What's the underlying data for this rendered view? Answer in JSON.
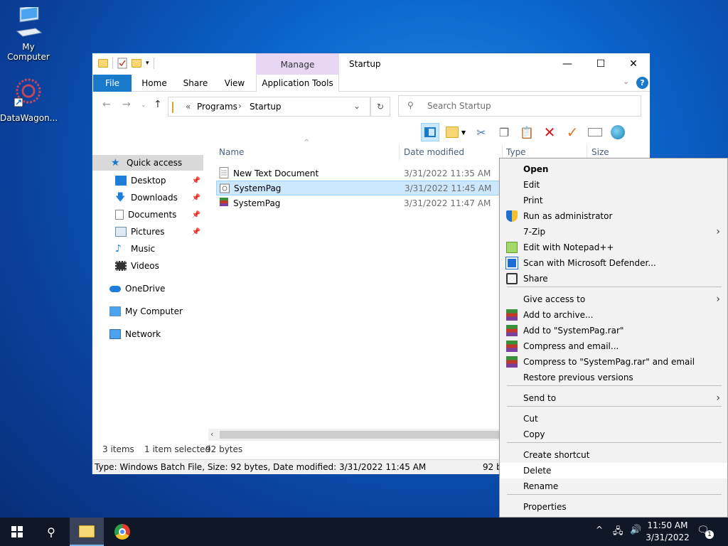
{
  "desktop": {
    "icons": [
      {
        "label": "My Computer",
        "icon": "computer-icon"
      },
      {
        "label": "DataWagon...",
        "icon": "datawagon-shortcut-icon"
      }
    ]
  },
  "window": {
    "title": "Startup",
    "manage_label": "Manage",
    "tabs": [
      "File",
      "Home",
      "Share",
      "View",
      "Application Tools"
    ],
    "controls": {
      "minimize": "—",
      "maximize": "☐",
      "close": "✕"
    },
    "help": "?",
    "address": {
      "crumbs_prefix": "«",
      "crumbs": [
        "Programs",
        "Startup"
      ]
    },
    "search_placeholder": "Search Startup",
    "nav": {
      "quick_access": "Quick access",
      "items": [
        "Desktop",
        "Downloads",
        "Documents",
        "Pictures",
        "Music",
        "Videos"
      ],
      "onedrive": "OneDrive",
      "computer": "My Computer",
      "network": "Network"
    },
    "columns": [
      "Name",
      "Date modified",
      "Type",
      "Size"
    ],
    "files": [
      {
        "name": "New Text Document",
        "date": "3/31/2022 11:35 AM",
        "selected": false
      },
      {
        "name": "SystemPag",
        "date": "3/31/2022 11:45 AM",
        "selected": true
      },
      {
        "name": "SystemPag",
        "date": "3/31/2022 11:47 AM",
        "selected": false
      }
    ],
    "status": {
      "items": "3 items",
      "selected": "1 item selected",
      "size": "92 bytes"
    },
    "info": "Type: Windows Batch File, Size: 92 bytes, Date modified: 3/31/2022 11:45 AM",
    "info_right": "92 b"
  },
  "context_menu": {
    "items": [
      {
        "label": "Open",
        "bold": true
      },
      {
        "label": "Edit"
      },
      {
        "label": "Print"
      },
      {
        "label": "Run as administrator",
        "icon": "uac-shield-icon"
      },
      {
        "label": "7-Zip",
        "submenu": true
      },
      {
        "label": "Edit with Notepad++",
        "icon": "notepadpp-icon"
      },
      {
        "label": "Scan with Microsoft Defender...",
        "icon": "defender-icon"
      },
      {
        "label": "Share",
        "icon": "share-icon"
      },
      {
        "label": "Give access to",
        "submenu": true
      },
      {
        "label": "Add to archive...",
        "icon": "winrar-icon"
      },
      {
        "label": "Add to \"SystemPag.rar\"",
        "icon": "winrar-icon"
      },
      {
        "label": "Compress and email...",
        "icon": "winrar-icon"
      },
      {
        "label": "Compress to \"SystemPag.rar\" and email",
        "icon": "winrar-icon"
      },
      {
        "label": "Restore previous versions"
      },
      {
        "label": "Send to",
        "submenu": true
      },
      {
        "label": "Cut"
      },
      {
        "label": "Copy"
      },
      {
        "label": "Create shortcut"
      },
      {
        "label": "Delete",
        "hover": true
      },
      {
        "label": "Rename"
      },
      {
        "label": "Properties"
      }
    ]
  },
  "taskbar": {
    "time": "11:50 AM",
    "date": "3/31/2022",
    "notification_count": "1"
  },
  "colors": {
    "accent": "#1979ca",
    "manage_tab": "#e6d8f4",
    "selection": "#cce8ff"
  }
}
